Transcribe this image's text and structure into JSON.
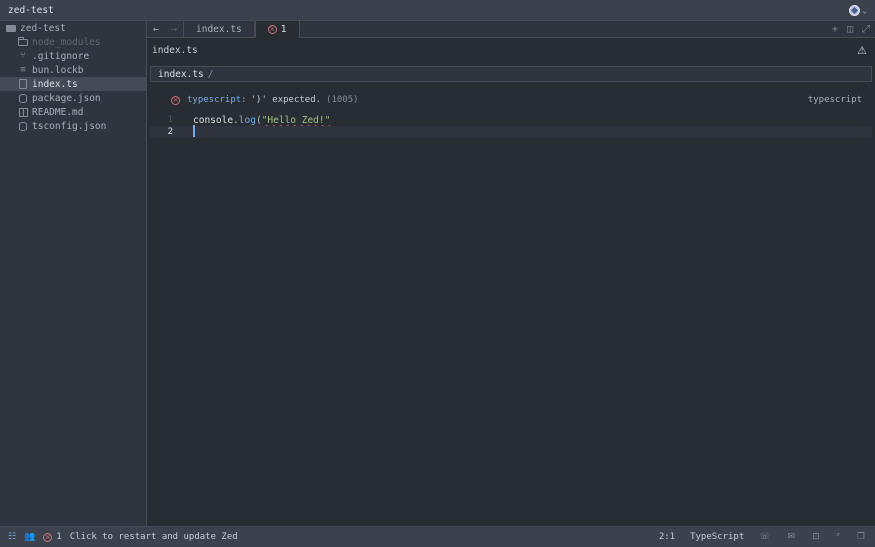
{
  "window": {
    "title": "zed-test"
  },
  "project_tree": {
    "root": "zed-test",
    "items": [
      {
        "label": "node_modules",
        "icon": "folder-icon"
      },
      {
        "label": ".gitignore",
        "icon": "git-icon"
      },
      {
        "label": "bun.lockb",
        "icon": "lock-file-icon"
      },
      {
        "label": "index.ts",
        "icon": "typescript-file-icon"
      },
      {
        "label": "package.json",
        "icon": "json-file-icon"
      },
      {
        "label": "README.md",
        "icon": "book-icon"
      },
      {
        "label": "tsconfig.json",
        "icon": "json-file-icon"
      }
    ]
  },
  "tabs": [
    {
      "label": "index.ts"
    },
    {
      "label": "1"
    }
  ],
  "breadcrumb": {
    "file": "index.ts"
  },
  "excerpt": {
    "file": "index.ts",
    "separator": "/"
  },
  "diagnostic": {
    "source": "typescript:",
    "message": "')' expected.",
    "code": "(1005)",
    "language": "typescript"
  },
  "code": {
    "line_numbers": [
      "1",
      "2"
    ],
    "tokens": {
      "ident": "console",
      "dot": ".",
      "method": "log",
      "open": "(",
      "string": "\"Hello Zed!\""
    }
  },
  "status_bar": {
    "error_count": "1",
    "message": "Click to restart and update Zed",
    "cursor_position": "2:1",
    "language": "TypeScript"
  },
  "colors": {
    "accent": "#74ade8",
    "error": "#d07277",
    "string": "#a1c181",
    "editor_bg": "#282c33",
    "panel_bg": "#2f343e"
  }
}
